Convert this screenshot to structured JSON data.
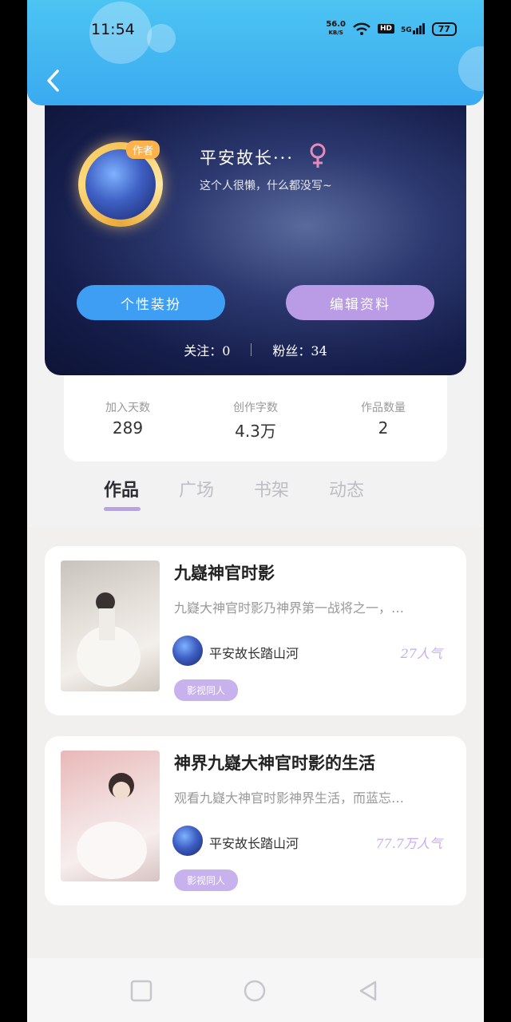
{
  "status_bar": {
    "time": "11:54",
    "speed_value": "56.0",
    "speed_unit": "KB/S",
    "hd": "HD",
    "network": "5G",
    "battery": "77"
  },
  "profile": {
    "author_tag": "作者",
    "name": "平安故长···",
    "gender_icon": "female-icon",
    "bio": "这个人很懒，什么都没写~",
    "dress_button": "个性装扮",
    "edit_button": "编辑资料",
    "following_label": "关注：",
    "following_count": "0",
    "fans_label": "粉丝：",
    "fans_count": "34"
  },
  "stats": [
    {
      "label": "加入天数",
      "value": "289"
    },
    {
      "label": "创作字数",
      "value": "4.3万"
    },
    {
      "label": "作品数量",
      "value": "2"
    }
  ],
  "tabs": [
    {
      "label": "作品",
      "active": true
    },
    {
      "label": "广场",
      "active": false
    },
    {
      "label": "书架",
      "active": false
    },
    {
      "label": "动态",
      "active": false
    }
  ],
  "works": [
    {
      "title": "九嶷神官时影",
      "description": "九嶷大神官时影乃神界第一战将之一，…",
      "author": "平安故长踏山河",
      "popularity": "27人气",
      "tag": "影视同人"
    },
    {
      "title": "神界九嶷大神官时影的生活",
      "description": "观看九嶷大神官时影神界生活，而蓝忘…",
      "author": "平安故长踏山河",
      "popularity": "77.7万人气",
      "tag": "影视同人"
    }
  ],
  "colors": {
    "header": "#3aaaf0",
    "dress_button": "#3d9ef3",
    "edit_button": "#b99be6",
    "tab_underline": "#b9a3e3",
    "tag": "#c7b2ee"
  }
}
